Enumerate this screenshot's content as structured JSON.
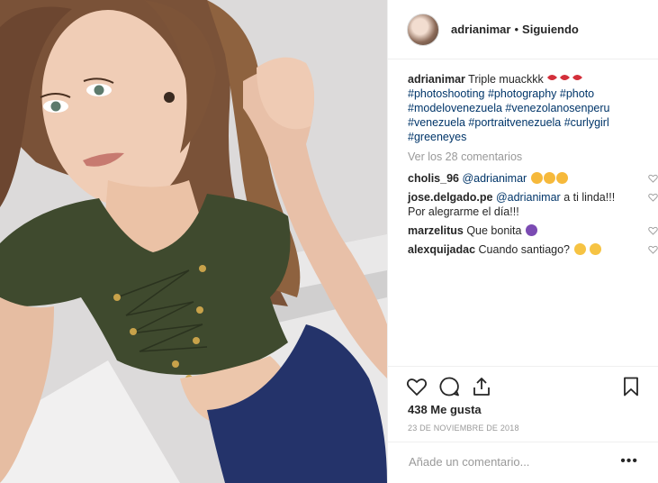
{
  "post": {
    "username": "adrianimar",
    "separator": "•",
    "follow_status": "Siguiendo",
    "photo_icon": "selfie-photo"
  },
  "caption": {
    "username": "adrianimar",
    "text": "Triple muackkk",
    "emoji": "kiss-mark-icon x3",
    "hashtags": "#photoshooting #photography #photo #modelovenezuela #venezolanosenperu #venezuela #portraitvenezuela #curlygirl #greeneyes"
  },
  "view_all": "Ver los 28 comentarios",
  "comments": [
    {
      "user": "cholis_96",
      "mention": "@adrianimar",
      "text": "",
      "emoji": "heart-eyes x3"
    },
    {
      "user": "jose.delgado.pe",
      "mention": "@adrianimar",
      "text": "a ti linda!!! Por alegrarme el día!!!",
      "emoji": ""
    },
    {
      "user": "marzelitus",
      "mention": "",
      "text": "Que bonita",
      "emoji": "purple-flower"
    },
    {
      "user": "alexquijadac",
      "mention": "",
      "text": "Cuando santiago?",
      "emoji": "flushed, smile"
    }
  ],
  "likes": "438 Me gusta",
  "date": "23 DE NOVIEMBRE DE 2018",
  "add_comment_placeholder": "Añade un comentario...",
  "more_label": "•••",
  "colors": {
    "link": "#003569",
    "muted": "#999999",
    "text": "#262626",
    "border": "#efefef",
    "shirt": "#3f4a2e",
    "pants": "#24336a"
  }
}
